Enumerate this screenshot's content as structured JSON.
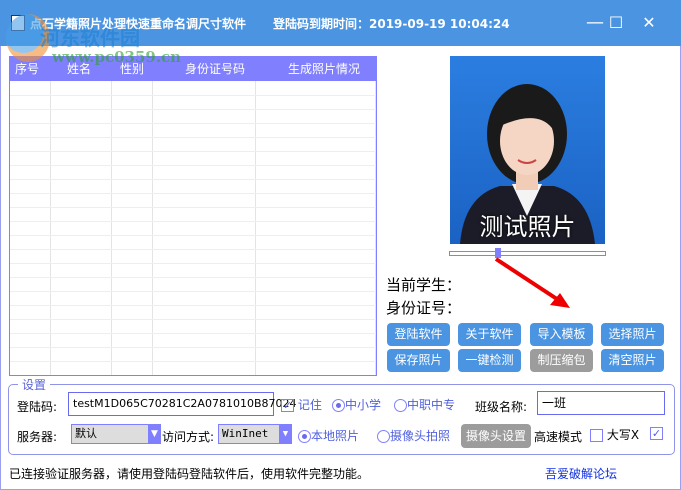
{
  "window": {
    "title": "点石学籍照片处理快速重命名调尺寸软件",
    "expiry": "登陆码到期时间：2019-09-19 10:04:24",
    "minimize": "—",
    "maximize": "☐",
    "close": "✕"
  },
  "watermark": {
    "name": "河东软件园",
    "url": "www.pc0359.cn"
  },
  "table": {
    "columns": [
      "序号",
      "姓名",
      "性别",
      "身份证号码",
      "生成照片情况"
    ],
    "rows": []
  },
  "photo": {
    "caption": "测试照片",
    "slider_value": 0.3
  },
  "student": {
    "current_label": "当前学生：",
    "id_label": "身份证号："
  },
  "buttons": {
    "login": "登陆软件",
    "about": "关于软件",
    "import": "导入模板",
    "select": "选择照片",
    "save": "保存照片",
    "check": "一键检测",
    "compress": "制压缩包",
    "clear": "清空照片"
  },
  "settings": {
    "title": "设置",
    "code_label": "登陆码:",
    "code_value": "testM1D065C70281C2A0781010B87024",
    "remember": "记住",
    "primary": "中小学",
    "vocational": "中职中专",
    "class_label": "班级名称:",
    "class_value": "一班",
    "server_label": "服务器:",
    "server_value": "默认",
    "access_label": "访问方式:",
    "access_value": "WinInet",
    "local_photo": "本地照片",
    "camera_photo": "摄像头拍照",
    "camera_settings": "摄像头设置",
    "fast_mode": "高速模式",
    "uppercase_x": "大写X"
  },
  "status": {
    "message": "已连接验证服务器，请使用登陆码登陆软件后，使用软件完整功能。",
    "forum": "吾爱破解论坛"
  }
}
